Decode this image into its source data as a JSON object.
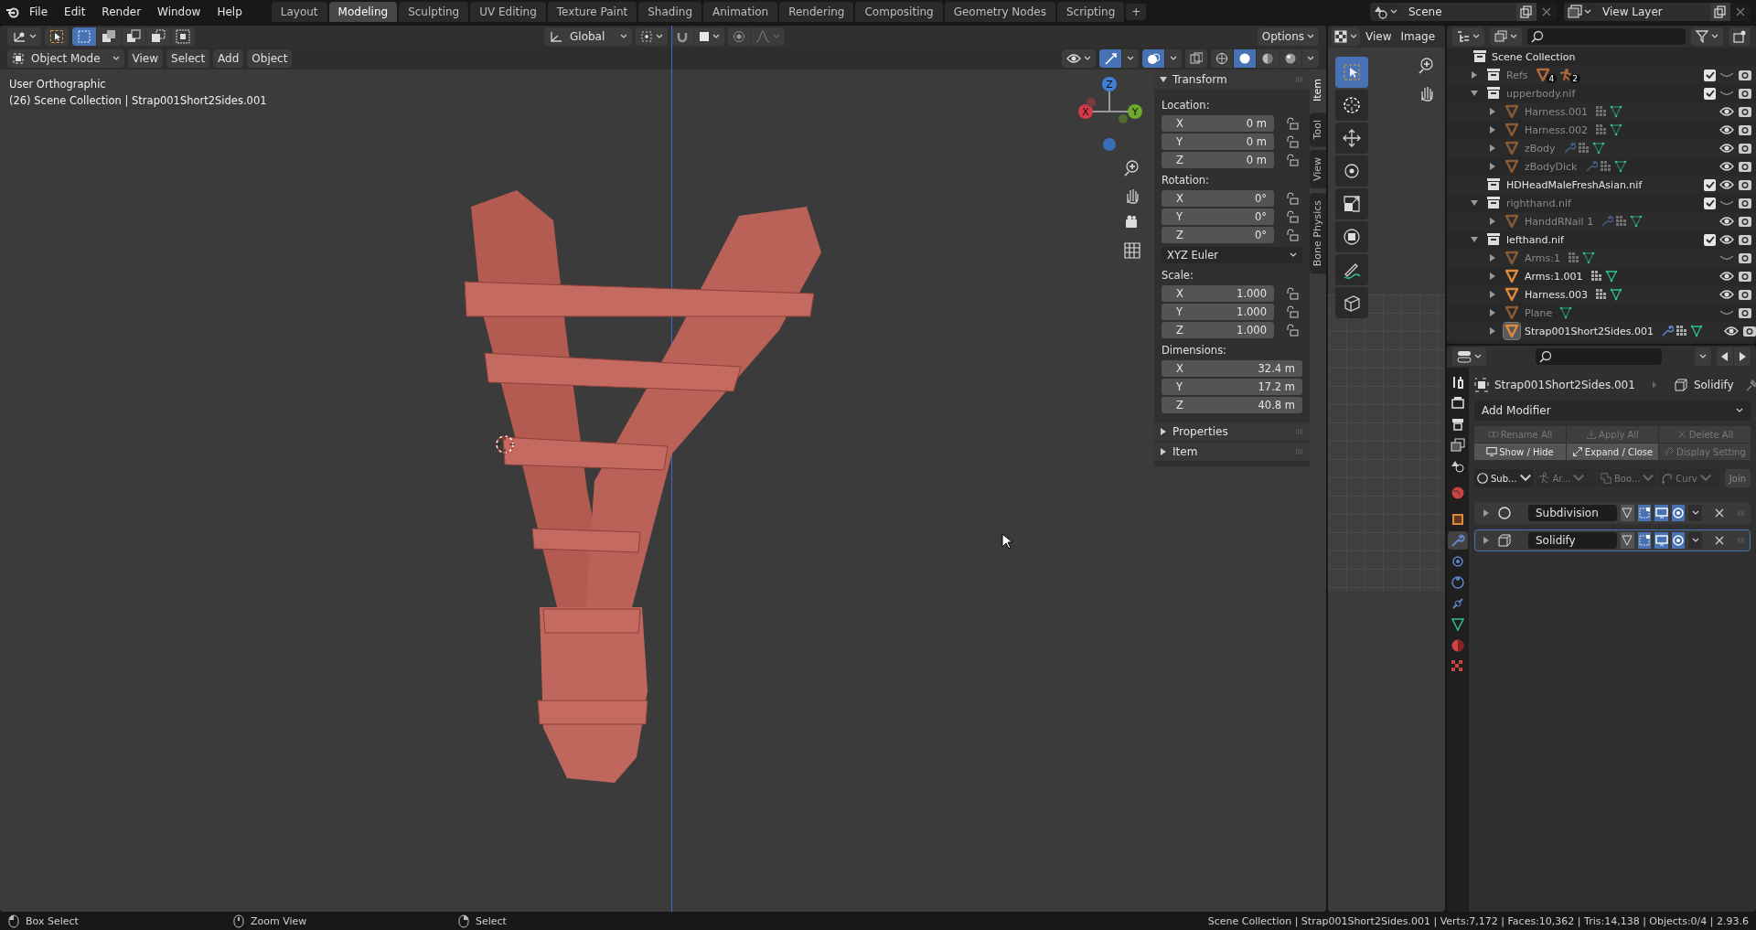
{
  "topbar": {
    "menus": [
      "File",
      "Edit",
      "Render",
      "Window",
      "Help"
    ],
    "workspaces": [
      {
        "label": "Layout",
        "selected": false
      },
      {
        "label": "Modeling",
        "selected": true
      },
      {
        "label": "Sculpting",
        "selected": false
      },
      {
        "label": "UV Editing",
        "selected": false
      },
      {
        "label": "Texture Paint",
        "selected": false
      },
      {
        "label": "Shading",
        "selected": false
      },
      {
        "label": "Animation",
        "selected": false
      },
      {
        "label": "Rendering",
        "selected": false
      },
      {
        "label": "Compositing",
        "selected": false
      },
      {
        "label": "Geometry Nodes",
        "selected": false
      },
      {
        "label": "Scripting",
        "selected": false
      }
    ],
    "add_tab": "+",
    "scene": "Scene",
    "view_layer": "View Layer"
  },
  "viewport": {
    "select_modes": [
      {
        "kind": "set",
        "selected": true
      },
      {
        "kind": "extend",
        "selected": false
      },
      {
        "kind": "subtract",
        "selected": false
      },
      {
        "kind": "invert",
        "selected": false
      },
      {
        "kind": "intersect",
        "selected": false
      }
    ],
    "orientation": "Global",
    "options": "Options",
    "mode": "Object Mode",
    "menus": [
      "View",
      "Select",
      "Add",
      "Object"
    ],
    "toggles": [
      {
        "kind": "gizmos",
        "on": true
      },
      {
        "kind": "overlays",
        "on": true
      },
      {
        "kind": "xray",
        "on": false
      }
    ],
    "shading": [
      {
        "kind": "wireframe",
        "selected": false
      },
      {
        "kind": "solid",
        "selected": true
      },
      {
        "kind": "material",
        "selected": false
      },
      {
        "kind": "rendered",
        "selected": false
      }
    ],
    "view_name": "User Orthographic",
    "info": "(26) Scene Collection | Strap001Short2Sides.001",
    "gizmo": {
      "x": "X",
      "y": "Y",
      "z": "Z"
    }
  },
  "sidebar": {
    "tabs": [
      {
        "label": "Item",
        "selected": true
      },
      {
        "label": "Tool",
        "selected": false
      },
      {
        "label": "View",
        "selected": false
      },
      {
        "label": "Bone Physics",
        "selected": false
      }
    ],
    "transform": {
      "title": "Transform",
      "expanded": true,
      "groups": [
        {
          "kind": "vector",
          "label": "Location:",
          "lockable": true,
          "fields": [
            {
              "axis": "X",
              "value": "0 m"
            },
            {
              "axis": "Y",
              "value": "0 m"
            },
            {
              "axis": "Z",
              "value": "0 m"
            }
          ]
        },
        {
          "kind": "vector",
          "label": "Rotation:",
          "lockable": true,
          "fields": [
            {
              "axis": "X",
              "value": "0°"
            },
            {
              "axis": "Y",
              "value": "0°"
            },
            {
              "axis": "Z",
              "value": "0°"
            }
          ]
        },
        {
          "kind": "dropdown",
          "value": "XYZ Euler"
        },
        {
          "kind": "vector",
          "label": "Scale:",
          "lockable": true,
          "fields": [
            {
              "axis": "X",
              "value": "1.000"
            },
            {
              "axis": "Y",
              "value": "1.000"
            },
            {
              "axis": "Z",
              "value": "1.000"
            }
          ]
        },
        {
          "kind": "vector",
          "label": "Dimensions:",
          "lockable": false,
          "fields": [
            {
              "axis": "X",
              "value": "32.4 m"
            },
            {
              "axis": "Y",
              "value": "17.2 m"
            },
            {
              "axis": "Z",
              "value": "40.8 m"
            }
          ]
        }
      ]
    },
    "panels": [
      {
        "title": "Properties",
        "expanded": false
      },
      {
        "title": "Item",
        "expanded": false
      }
    ]
  },
  "image_editor": {
    "menus": [
      "View",
      "Image"
    ]
  },
  "outliner": {
    "root": "Scene Collection",
    "items": [
      {
        "name": "Refs",
        "kind": "collection",
        "expanded": false,
        "checked": true,
        "visible": false,
        "selected": false,
        "badges": [
          "4",
          "2"
        ]
      },
      {
        "name": "upperbody.nif",
        "kind": "collection",
        "expanded": true,
        "checked": true,
        "visible": false,
        "selected": false,
        "children": [
          {
            "name": "Harness.001",
            "kind": "mesh",
            "expanded": false,
            "visible": true,
            "selected": false,
            "modifier": false,
            "vertex_groups": true
          },
          {
            "name": "Harness.002",
            "kind": "mesh",
            "expanded": false,
            "visible": true,
            "selected": false,
            "modifier": false,
            "vertex_groups": true
          },
          {
            "name": "zBody",
            "kind": "mesh",
            "expanded": false,
            "visible": true,
            "selected": false,
            "modifier": true,
            "vertex_groups": true
          },
          {
            "name": "zBodyDick",
            "kind": "mesh",
            "expanded": false,
            "visible": true,
            "selected": false,
            "modifier": true,
            "vertex_groups": true
          }
        ]
      },
      {
        "name": "HDHeadMaleFreshAsian.nif",
        "kind": "collection",
        "checked": true,
        "visible": true,
        "selected": false
      },
      {
        "name": "righthand.nif",
        "kind": "collection",
        "expanded": true,
        "checked": true,
        "visible": false,
        "selected": false,
        "children": [
          {
            "name": "HanddRNail 1",
            "kind": "mesh",
            "expanded": false,
            "visible": true,
            "selected": false,
            "modifier": true,
            "vertex_groups": true
          }
        ]
      },
      {
        "name": "lefthand.nif",
        "kind": "collection",
        "expanded": true,
        "checked": true,
        "visible": true,
        "selected": false,
        "children": [
          {
            "name": "Arms:1",
            "kind": "mesh",
            "expanded": false,
            "visible": false,
            "selected": false,
            "modifier": false,
            "vertex_groups": true
          },
          {
            "name": "Arms:1.001",
            "kind": "mesh",
            "expanded": false,
            "visible": true,
            "selected": false,
            "modifier": false,
            "vertex_groups": true
          },
          {
            "name": "Harness.003",
            "kind": "mesh",
            "expanded": false,
            "visible": true,
            "selected": false,
            "modifier": false,
            "vertex_groups": true
          },
          {
            "name": "Plane",
            "kind": "mesh",
            "expanded": false,
            "visible": false,
            "selected": false,
            "modifier": false,
            "vertex_groups": false
          },
          {
            "name": "Strap001Short2Sides.001",
            "kind": "mesh",
            "expanded": false,
            "visible": true,
            "selected": true,
            "modifier": true,
            "vertex_groups": true
          }
        ]
      }
    ]
  },
  "properties": {
    "tabs": [
      {
        "kind": "tool",
        "selected": false
      },
      {
        "kind": "render",
        "selected": false
      },
      {
        "kind": "output",
        "selected": false
      },
      {
        "kind": "view_layer",
        "selected": false
      },
      {
        "kind": "scene",
        "selected": false
      },
      {
        "kind": "world",
        "selected": false
      },
      {
        "kind": "object",
        "selected": false
      },
      {
        "kind": "modifiers",
        "selected": true
      },
      {
        "kind": "particles",
        "selected": false
      },
      {
        "kind": "physics",
        "selected": false
      },
      {
        "kind": "constraints",
        "selected": false
      },
      {
        "kind": "data",
        "selected": false
      },
      {
        "kind": "material",
        "selected": false
      },
      {
        "kind": "texture",
        "selected": false
      }
    ],
    "object": "Strap001Short2Sides.001",
    "modifier": "Solidify",
    "add_modifier": "Add Modifier",
    "actions": [
      {
        "label": "Rename All",
        "kind": "rename",
        "disabled": true
      },
      {
        "label": "Apply All",
        "kind": "apply",
        "disabled": true
      },
      {
        "label": "Delete All",
        "kind": "delete",
        "disabled": true
      },
      {
        "label": "Show / Hide",
        "kind": "show",
        "disabled": false
      },
      {
        "label": "Expand / Close",
        "kind": "expand",
        "disabled": false
      },
      {
        "label": "Display Setting",
        "kind": "link",
        "disabled": true
      }
    ],
    "quick": [
      {
        "label": "Sub...",
        "kind": "subdivision",
        "disabled": false
      },
      {
        "label": "Ar...",
        "kind": "armature",
        "disabled": true
      },
      {
        "label": "Boo...",
        "kind": "boolean",
        "disabled": true
      },
      {
        "label": "Curv",
        "kind": "curve",
        "disabled": true
      }
    ],
    "join": "Join",
    "modifiers": [
      {
        "name": "Subdivision",
        "kind": "subdivision",
        "selected": false
      },
      {
        "name": "Solidify",
        "kind": "solidify",
        "selected": true
      }
    ]
  },
  "status_bar": {
    "hints": [
      {
        "kind": "left",
        "label": "Box Select"
      },
      {
        "kind": "middle",
        "label": "Zoom View"
      },
      {
        "kind": "right",
        "label": "Select"
      }
    ],
    "stats": "Scene Collection | Strap001Short2Sides.001 | Verts:7,172 | Faces:10,362 | Tris:14,138 | Objects:0/4 | 2.93.6"
  }
}
